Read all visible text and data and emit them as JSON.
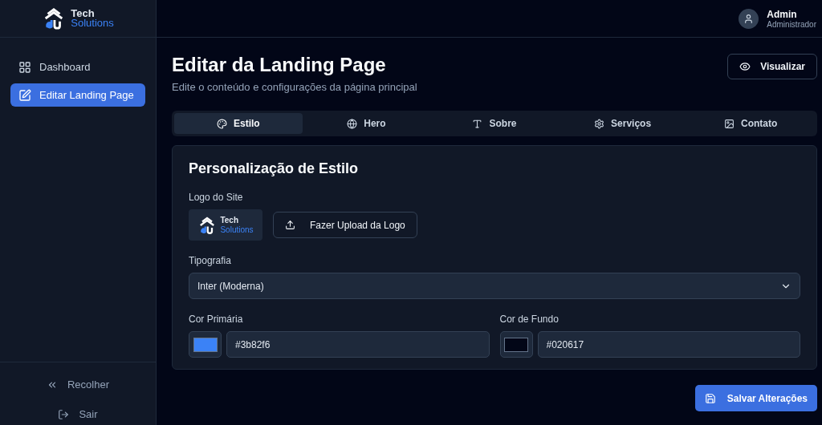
{
  "sidebar": {
    "logo": {
      "line_1": "Tech",
      "line_2": "Solutions"
    },
    "items": [
      {
        "label": "Dashboard",
        "selected": false
      },
      {
        "label": "Editar Landing Page",
        "selected": true
      }
    ],
    "footer": [
      {
        "label": "Recolher"
      },
      {
        "label": "Sair"
      }
    ]
  },
  "user": {
    "name": "Admin",
    "role": "Administrador"
  },
  "page": {
    "title": "Editar da Landing Page",
    "subtitle": "Edite o conteúdo e configurações da página principal",
    "preview_button": "Visualizar"
  },
  "tabs": [
    {
      "label": "Estilo",
      "selected": true
    },
    {
      "label": "Hero",
      "selected": false
    },
    {
      "label": "Sobre",
      "selected": false
    },
    {
      "label": "Serviços",
      "selected": false
    },
    {
      "label": "Contato",
      "selected": false
    }
  ],
  "style_card": {
    "title": "Personalização de Estilo",
    "logo_label": "Logo do Site",
    "logo_preview": {
      "line_1": "Tech",
      "line_2": "Solutions"
    },
    "upload_button": "Fazer Upload da Logo",
    "typography_label": "Tipografia",
    "typography_value": "Inter (Moderna)",
    "colors": [
      {
        "label": "Cor Primária",
        "value": "#3b82f6",
        "color": "#3b82f6"
      },
      {
        "label": "Cor de Fundo",
        "value": "#020617",
        "color": "#020617"
      }
    ]
  },
  "save_button": "Salvar Alterações"
}
